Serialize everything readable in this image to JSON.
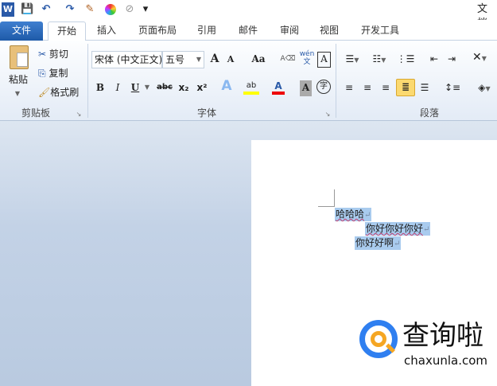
{
  "window": {
    "title": "文档"
  },
  "qat": {
    "word": "W",
    "save": "💾",
    "undo": "↶",
    "redo": "↷",
    "customize": "▾"
  },
  "tabs": [
    {
      "label": "文件"
    },
    {
      "label": "开始"
    },
    {
      "label": "插入"
    },
    {
      "label": "页面布局"
    },
    {
      "label": "引用"
    },
    {
      "label": "邮件"
    },
    {
      "label": "审阅"
    },
    {
      "label": "视图"
    },
    {
      "label": "开发工具"
    }
  ],
  "clipboard": {
    "paste": "粘贴",
    "cut": "剪切",
    "copy": "复制",
    "format_painter": "格式刷",
    "group": "剪贴板"
  },
  "font": {
    "name": "宋体 (中文正文)",
    "size": "五号",
    "grow": "A",
    "shrink": "A",
    "case": "Aa",
    "bold": "B",
    "italic": "I",
    "underline": "U",
    "strike": "abc",
    "sub": "x₂",
    "sup": "x²",
    "text_effect": "A",
    "highlight": "ab",
    "color": "A",
    "shading": "A",
    "enclose": "字",
    "pinyin": "wén",
    "border": "A",
    "group": "字体"
  },
  "paragraph": {
    "group": "段落"
  },
  "document": {
    "lines": [
      "哈哈哈",
      "你好你好你好",
      "你好好啊"
    ]
  },
  "watermark": {
    "name": "查询啦",
    "url": "chaxunla.com"
  }
}
